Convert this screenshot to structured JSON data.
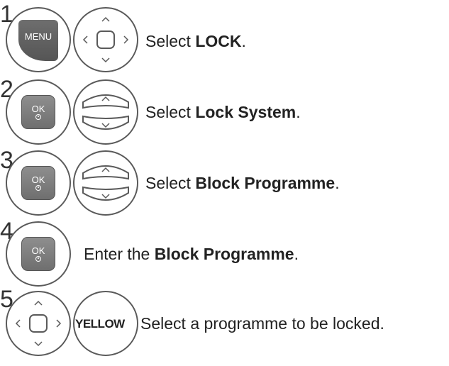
{
  "steps": [
    {
      "number": "1",
      "key_label": "MENU",
      "text_before": "Select ",
      "text_bold": "LOCK",
      "text_after": "."
    },
    {
      "number": "2",
      "key_label": "OK",
      "text_before": "Select ",
      "text_bold": "Lock System",
      "text_after": "."
    },
    {
      "number": "3",
      "key_label": "OK",
      "text_before": "Select ",
      "text_bold": "Block Programme",
      "text_after": "."
    },
    {
      "number": "4",
      "key_label": "OK",
      "text_before": "Enter the ",
      "text_bold": "Block Programme",
      "text_after": "."
    },
    {
      "number": "5",
      "key_label": "YELLOW",
      "text_before": "Select a programme to be locked.",
      "text_bold": "",
      "text_after": ""
    }
  ],
  "icons": {
    "navigation_pad": "navigation-pad-icon",
    "updown_button": "up-down-button-icon",
    "ok_button": "ok-button-icon",
    "menu_button": "menu-button-icon"
  }
}
